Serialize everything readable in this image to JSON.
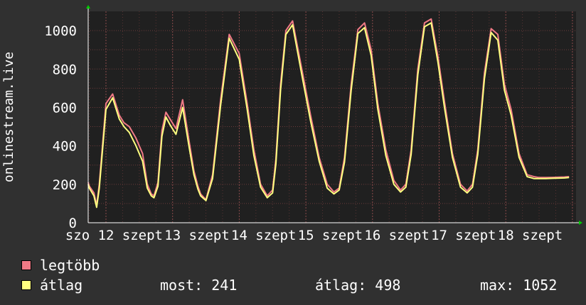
{
  "chart_data": {
    "type": "line",
    "ylabel": "onlinestream.live",
    "ylim": [
      0,
      1100
    ],
    "y_ticks": [
      "0",
      "200",
      "400",
      "600",
      "800",
      "1000"
    ],
    "x_tick_labels": [
      "szo 12 szept",
      "13 szept",
      "14 szept",
      "15 szept",
      "16 szept",
      "17 szept",
      "18 szept"
    ],
    "x_tick_display": [
      {
        "prefix": "szo",
        "day": "12",
        "suffix": "szept"
      },
      {
        "prefix": "",
        "day": "13",
        "suffix": "szept"
      },
      {
        "prefix": "",
        "day": "14",
        "suffix": "szept"
      },
      {
        "prefix": "",
        "day": "15",
        "suffix": "szept"
      },
      {
        "prefix": "",
        "day": "16",
        "suffix": "szept"
      },
      {
        "prefix": "",
        "day": "17",
        "suffix": "szept"
      },
      {
        "prefix": "",
        "day": "18",
        "suffix": "szept"
      }
    ],
    "grid": true,
    "x_days": [
      0,
      1,
      2,
      3,
      4,
      5,
      6,
      7
    ],
    "series": [
      {
        "name": "legtöbb",
        "color": "#f07a86",
        "x": [
          -0.32,
          -0.25,
          -0.18,
          -0.14,
          -0.1,
          0.0,
          0.1,
          0.2,
          0.27,
          0.35,
          0.45,
          0.55,
          0.62,
          0.68,
          0.72,
          0.78,
          0.84,
          0.9,
          0.96,
          1.05,
          1.15,
          1.25,
          1.32,
          1.38,
          1.42,
          1.5,
          1.6,
          1.72,
          1.85,
          2.0,
          2.12,
          2.22,
          2.32,
          2.42,
          2.5,
          2.55,
          2.62,
          2.7,
          2.8,
          2.95,
          3.07,
          3.2,
          3.32,
          3.42,
          3.5,
          3.58,
          3.68,
          3.78,
          3.88,
          3.98,
          4.08,
          4.2,
          4.32,
          4.42,
          4.5,
          4.58,
          4.68,
          4.78,
          4.88,
          4.98,
          5.08,
          5.2,
          5.32,
          5.42,
          5.5,
          5.58,
          5.68,
          5.78,
          5.88,
          5.98,
          6.08,
          6.2,
          6.32,
          6.42,
          6.5,
          6.6,
          6.7,
          6.8,
          6.88,
          6.95
        ],
        "y": [
          210,
          190,
          155,
          90,
          200,
          620,
          670,
          560,
          520,
          500,
          440,
          360,
          200,
          150,
          140,
          210,
          480,
          575,
          540,
          490,
          640,
          420,
          270,
          190,
          150,
          120,
          250,
          640,
          980,
          880,
          620,
          380,
          200,
          140,
          170,
          330,
          720,
          1000,
          1050,
          780,
          560,
          340,
          200,
          160,
          180,
          340,
          720,
          1005,
          1040,
          900,
          620,
          380,
          220,
          170,
          200,
          380,
          800,
          1040,
          1060,
          870,
          630,
          360,
          200,
          165,
          200,
          380,
          780,
          1010,
          980,
          720,
          590,
          360,
          250,
          240,
          235,
          235,
          236,
          237,
          238,
          240
        ]
      },
      {
        "name": "átlag",
        "color": "#ffff80",
        "x": [
          -0.32,
          -0.25,
          -0.18,
          -0.14,
          -0.1,
          0.0,
          0.1,
          0.2,
          0.27,
          0.35,
          0.45,
          0.55,
          0.62,
          0.68,
          0.72,
          0.78,
          0.84,
          0.9,
          0.96,
          1.05,
          1.15,
          1.25,
          1.32,
          1.38,
          1.42,
          1.5,
          1.6,
          1.72,
          1.85,
          2.0,
          2.12,
          2.22,
          2.32,
          2.42,
          2.5,
          2.55,
          2.62,
          2.7,
          2.8,
          2.95,
          3.07,
          3.2,
          3.32,
          3.42,
          3.5,
          3.58,
          3.68,
          3.78,
          3.88,
          3.98,
          4.08,
          4.2,
          4.32,
          4.42,
          4.5,
          4.58,
          4.68,
          4.78,
          4.88,
          4.98,
          5.08,
          5.2,
          5.32,
          5.42,
          5.5,
          5.58,
          5.68,
          5.78,
          5.88,
          5.98,
          6.08,
          6.2,
          6.32,
          6.42,
          6.5,
          6.6,
          6.7,
          6.8,
          6.88,
          6.95
        ],
        "y": [
          200,
          180,
          140,
          80,
          180,
          590,
          650,
          540,
          500,
          470,
          400,
          320,
          180,
          140,
          130,
          190,
          450,
          550,
          510,
          460,
          600,
          390,
          250,
          175,
          140,
          115,
          230,
          610,
          960,
          850,
          590,
          350,
          185,
          130,
          155,
          305,
          690,
          980,
          1030,
          750,
          530,
          320,
          180,
          150,
          170,
          315,
          690,
          985,
          1015,
          870,
          590,
          350,
          200,
          160,
          185,
          355,
          770,
          1020,
          1040,
          840,
          600,
          340,
          185,
          155,
          185,
          355,
          750,
          990,
          950,
          690,
          560,
          340,
          240,
          230,
          230,
          230,
          231,
          232,
          233,
          235
        ]
      }
    ]
  },
  "legend": [
    {
      "label": "legtöbb",
      "color": "#f07a86"
    },
    {
      "label": "átlag",
      "color": "#ffff80"
    }
  ],
  "stats": {
    "now": "most: 241",
    "average": "átlag: 498",
    "max": "max: 1052"
  }
}
